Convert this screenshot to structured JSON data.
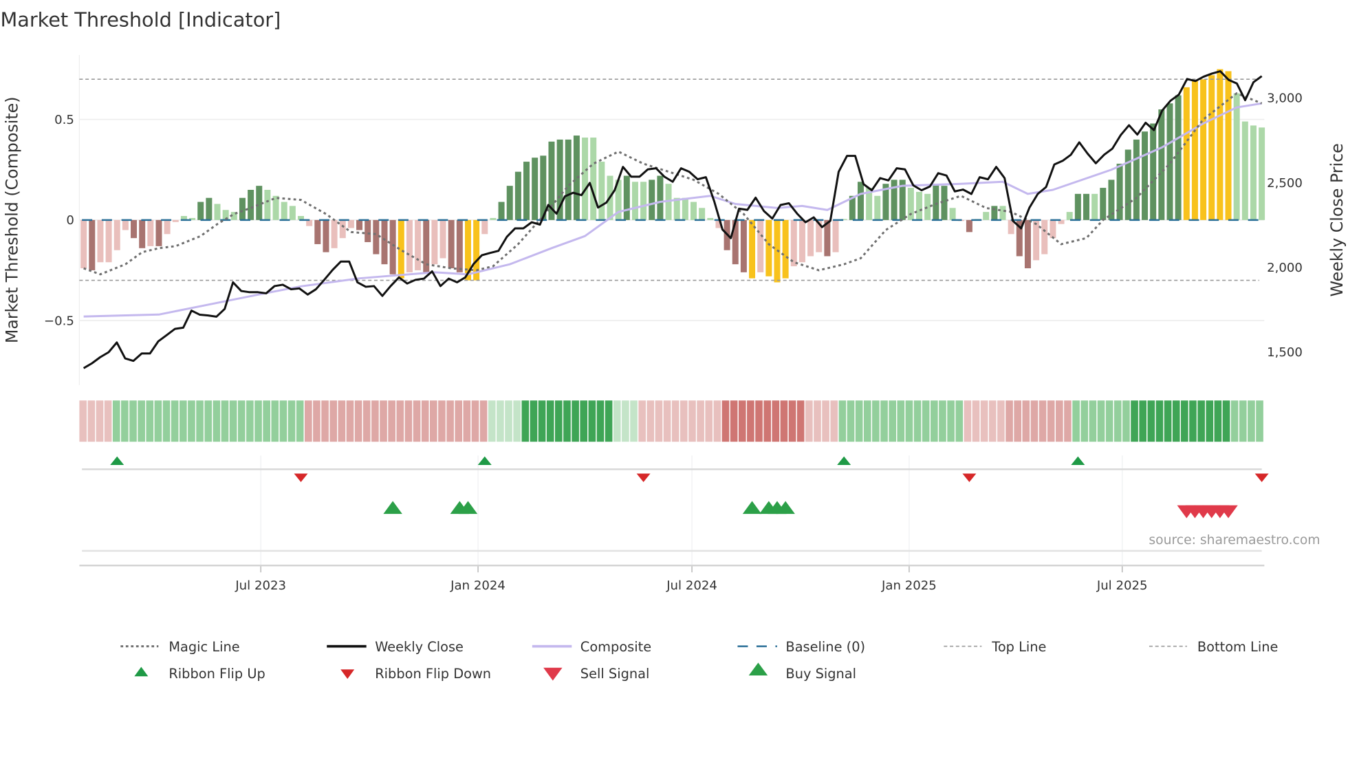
{
  "chart_data": {
    "type": "bar",
    "title": "Market Threshold [Indicator]",
    "ylabel": "Market Threshold (Composite)",
    "y2label": "Weekly Close Price",
    "ylim": [
      -0.85,
      0.82
    ],
    "y2lim": [
      1300,
      3350
    ],
    "left_ticks": [
      {
        "value": 0.5,
        "label": "0.5"
      },
      {
        "value": 0,
        "label": "0"
      },
      {
        "value": -0.5,
        "label": "−0.5"
      }
    ],
    "right_ticks": [
      {
        "value": 3000,
        "label": "3,000"
      },
      {
        "value": 2500,
        "label": "2,500"
      },
      {
        "value": 2000,
        "label": "2,000"
      },
      {
        "value": 1500,
        "label": "1,500"
      }
    ],
    "x_ticks": [
      {
        "week": 21.2,
        "label": "Jul 2023"
      },
      {
        "week": 47.2,
        "label": "Jan 2024"
      },
      {
        "week": 72.8,
        "label": "Jul 2024"
      },
      {
        "week": 98.8,
        "label": "Jan 2025"
      },
      {
        "week": 124.3,
        "label": "Jul 2025"
      }
    ],
    "top_line": 0.7,
    "bottom_line": -0.3,
    "baseline": 0,
    "bar_colors": {
      "pos_strong": "#5f9260",
      "pos_weak": "#acd8a8",
      "neg_strong": "#a87470",
      "neg_weak": "#e9bfbc",
      "extreme": "#f8c21c"
    },
    "bars": [
      [
        "w",
        -0.24
      ],
      [
        "s",
        -0.25
      ],
      [
        "w",
        -0.21
      ],
      [
        "w",
        -0.21
      ],
      [
        "w",
        -0.15
      ],
      [
        "w",
        -0.05
      ],
      [
        "s",
        -0.09
      ],
      [
        "s",
        -0.14
      ],
      [
        "w",
        -0.13
      ],
      [
        "s",
        -0.13
      ],
      [
        "w",
        -0.07
      ],
      [
        "w",
        -0.01
      ],
      [
        "w",
        0.02
      ],
      [
        "w",
        0.01
      ],
      [
        "s",
        0.09
      ],
      [
        "s",
        0.11
      ],
      [
        "w",
        0.08
      ],
      [
        "w",
        0.05
      ],
      [
        "w",
        0.04
      ],
      [
        "s",
        0.11
      ],
      [
        "s",
        0.15
      ],
      [
        "s",
        0.17
      ],
      [
        "w",
        0.15
      ],
      [
        "w",
        0.12
      ],
      [
        "w",
        0.09
      ],
      [
        "w",
        0.07
      ],
      [
        "w",
        0.02
      ],
      [
        "w",
        -0.03
      ],
      [
        "s",
        -0.12
      ],
      [
        "s",
        -0.16
      ],
      [
        "w",
        -0.14
      ],
      [
        "w",
        -0.09
      ],
      [
        "w",
        -0.04
      ],
      [
        "s",
        -0.05
      ],
      [
        "s",
        -0.11
      ],
      [
        "s",
        -0.17
      ],
      [
        "s",
        -0.22
      ],
      [
        "s",
        -0.27
      ],
      [
        "y",
        -0.29
      ],
      [
        "w",
        -0.26
      ],
      [
        "w",
        -0.25
      ],
      [
        "s",
        -0.26
      ],
      [
        "w",
        -0.22
      ],
      [
        "w",
        -0.19
      ],
      [
        "s",
        -0.24
      ],
      [
        "s",
        -0.26
      ],
      [
        "y",
        -0.3
      ],
      [
        "y",
        -0.3
      ],
      [
        "w",
        -0.07
      ],
      [
        "w",
        0.01
      ],
      [
        "s",
        0.09
      ],
      [
        "s",
        0.17
      ],
      [
        "s",
        0.24
      ],
      [
        "s",
        0.29
      ],
      [
        "s",
        0.31
      ],
      [
        "s",
        0.32
      ],
      [
        "s",
        0.39
      ],
      [
        "s",
        0.4
      ],
      [
        "s",
        0.4
      ],
      [
        "s",
        0.42
      ],
      [
        "w",
        0.41
      ],
      [
        "w",
        0.41
      ],
      [
        "w",
        0.29
      ],
      [
        "w",
        0.22
      ],
      [
        "w",
        0.2
      ],
      [
        "s",
        0.22
      ],
      [
        "w",
        0.19
      ],
      [
        "w",
        0.19
      ],
      [
        "s",
        0.2
      ],
      [
        "s",
        0.22
      ],
      [
        "w",
        0.18
      ],
      [
        "w",
        0.11
      ],
      [
        "w",
        0.11
      ],
      [
        "w",
        0.09
      ],
      [
        "w",
        0.06
      ],
      [
        "w",
        0.01
      ],
      [
        "w",
        -0.04
      ],
      [
        "s",
        -0.15
      ],
      [
        "s",
        -0.22
      ],
      [
        "s",
        -0.26
      ],
      [
        "y",
        -0.29
      ],
      [
        "w",
        -0.26
      ],
      [
        "y",
        -0.28
      ],
      [
        "y",
        -0.31
      ],
      [
        "y",
        -0.29
      ],
      [
        "w",
        -0.23
      ],
      [
        "w",
        -0.21
      ],
      [
        "w",
        -0.18
      ],
      [
        "w",
        -0.16
      ],
      [
        "s",
        -0.18
      ],
      [
        "w",
        -0.16
      ],
      [
        "w",
        0.005
      ],
      [
        "s",
        0.12
      ],
      [
        "s",
        0.19
      ],
      [
        "w",
        0.16
      ],
      [
        "w",
        0.12
      ],
      [
        "s",
        0.18
      ],
      [
        "s",
        0.2
      ],
      [
        "s",
        0.2
      ],
      [
        "w",
        0.16
      ],
      [
        "w",
        0.14
      ],
      [
        "w",
        0.13
      ],
      [
        "s",
        0.18
      ],
      [
        "s",
        0.17
      ],
      [
        "w",
        0.06
      ],
      [
        "w",
        -0.005
      ],
      [
        "s",
        -0.06
      ],
      [
        "w",
        0.005
      ],
      [
        "w",
        0.04
      ],
      [
        "s",
        0.07
      ],
      [
        "w",
        0.07
      ],
      [
        "w",
        -0.07
      ],
      [
        "s",
        -0.18
      ],
      [
        "s",
        -0.24
      ],
      [
        "w",
        -0.2
      ],
      [
        "w",
        -0.17
      ],
      [
        "w",
        -0.09
      ],
      [
        "w",
        -0.02
      ],
      [
        "w",
        0.04
      ],
      [
        "s",
        0.13
      ],
      [
        "s",
        0.13
      ],
      [
        "w",
        0.13
      ],
      [
        "s",
        0.16
      ],
      [
        "s",
        0.2
      ],
      [
        "s",
        0.28
      ],
      [
        "s",
        0.35
      ],
      [
        "s",
        0.4
      ],
      [
        "s",
        0.44
      ],
      [
        "s",
        0.48
      ],
      [
        "s",
        0.55
      ],
      [
        "s",
        0.58
      ],
      [
        "s",
        0.62
      ],
      [
        "y",
        0.66
      ],
      [
        "y",
        0.69
      ],
      [
        "y",
        0.7
      ],
      [
        "y",
        0.72
      ],
      [
        "y",
        0.75
      ],
      [
        "y",
        0.74
      ],
      [
        "w",
        0.63
      ],
      [
        "w",
        0.49
      ],
      [
        "w",
        0.47
      ],
      [
        "w",
        0.46
      ]
    ],
    "weekly_close": [
      1404,
      1433,
      1469,
      1498,
      1556,
      1462,
      1447,
      1491,
      1491,
      1563,
      1599,
      1636,
      1643,
      1744,
      1720,
      1715,
      1708,
      1754,
      1911,
      1860,
      1853,
      1853,
      1846,
      1889,
      1897,
      1870,
      1875,
      1839,
      1870,
      1926,
      1984,
      2034,
      2034,
      1911,
      1885,
      1889,
      1831,
      1889,
      1940,
      1904,
      1926,
      1933,
      1976,
      1889,
      1933,
      1911,
      1940,
      2020,
      2071,
      2085,
      2097,
      2179,
      2230,
      2230,
      2266,
      2252,
      2368,
      2317,
      2419,
      2440,
      2426,
      2498,
      2353,
      2382,
      2455,
      2593,
      2535,
      2535,
      2578,
      2585,
      2535,
      2505,
      2585,
      2564,
      2520,
      2532,
      2390,
      2223,
      2172,
      2346,
      2339,
      2411,
      2332,
      2288,
      2368,
      2378,
      2317,
      2266,
      2295,
      2237,
      2274,
      2564,
      2658,
      2658,
      2491,
      2455,
      2527,
      2513,
      2585,
      2578,
      2484,
      2455,
      2477,
      2556,
      2542,
      2448,
      2459,
      2433,
      2532,
      2520,
      2593,
      2527,
      2274,
      2230,
      2353,
      2433,
      2474,
      2607,
      2629,
      2665,
      2738,
      2672,
      2614,
      2665,
      2701,
      2781,
      2839,
      2784,
      2854,
      2810,
      2926,
      2984,
      3020,
      3112,
      3100,
      3126,
      3144,
      3158,
      3107,
      3086,
      2987,
      3093,
      3129
    ],
    "composite": [
      [
        0,
        -0.48
      ],
      [
        9,
        -0.47
      ],
      [
        15,
        -0.42
      ],
      [
        21,
        -0.37
      ],
      [
        26,
        -0.33
      ],
      [
        33,
        -0.29
      ],
      [
        36,
        -0.28
      ],
      [
        42,
        -0.26
      ],
      [
        46,
        -0.27
      ],
      [
        51,
        -0.22
      ],
      [
        56,
        -0.14
      ],
      [
        60,
        -0.08
      ],
      [
        64,
        0.04
      ],
      [
        69,
        0.09
      ],
      [
        75,
        0.12
      ],
      [
        78,
        0.08
      ],
      [
        83,
        0.06
      ],
      [
        86,
        0.07
      ],
      [
        89,
        0.05
      ],
      [
        93,
        0.13
      ],
      [
        98,
        0.17
      ],
      [
        105,
        0.18
      ],
      [
        110,
        0.19
      ],
      [
        113,
        0.13
      ],
      [
        116,
        0.15
      ],
      [
        123,
        0.25
      ],
      [
        129,
        0.36
      ],
      [
        134,
        0.48
      ],
      [
        138,
        0.56
      ],
      [
        141,
        0.58
      ]
    ],
    "magic_line": [
      [
        0,
        -0.24
      ],
      [
        2,
        -0.27
      ],
      [
        5,
        -0.22
      ],
      [
        7,
        -0.16
      ],
      [
        9,
        -0.14
      ],
      [
        11,
        -0.13
      ],
      [
        14,
        -0.08
      ],
      [
        16,
        -0.02
      ],
      [
        18,
        0.03
      ],
      [
        20,
        0.06
      ],
      [
        23,
        0.11
      ],
      [
        26,
        0.1
      ],
      [
        29,
        0.03
      ],
      [
        32,
        -0.06
      ],
      [
        35,
        -0.07
      ],
      [
        38,
        -0.15
      ],
      [
        41,
        -0.22
      ],
      [
        44,
        -0.24
      ],
      [
        47,
        -0.25
      ],
      [
        49,
        -0.23
      ],
      [
        52,
        -0.12
      ],
      [
        55,
        0.02
      ],
      [
        58,
        0.17
      ],
      [
        61,
        0.28
      ],
      [
        64,
        0.34
      ],
      [
        67,
        0.28
      ],
      [
        70,
        0.24
      ],
      [
        73,
        0.2
      ],
      [
        76,
        0.13
      ],
      [
        79,
        0.03
      ],
      [
        82,
        -0.12
      ],
      [
        85,
        -0.21
      ],
      [
        88,
        -0.25
      ],
      [
        91,
        -0.22
      ],
      [
        93,
        -0.19
      ],
      [
        96,
        -0.05
      ],
      [
        99,
        0.03
      ],
      [
        102,
        0.08
      ],
      [
        105,
        0.12
      ],
      [
        108,
        0.06
      ],
      [
        111,
        0.04
      ],
      [
        114,
        -0.02
      ],
      [
        117,
        -0.12
      ],
      [
        120,
        -0.09
      ],
      [
        122,
        0.0
      ],
      [
        126,
        0.11
      ],
      [
        130,
        0.28
      ],
      [
        134,
        0.5
      ],
      [
        138,
        0.63
      ],
      [
        141,
        0.58
      ]
    ],
    "ribbon_strength": [
      -1,
      -1,
      -1,
      -1,
      2,
      2,
      2,
      2,
      2,
      2,
      2,
      2,
      2,
      2,
      2,
      2,
      2,
      2,
      2,
      2,
      2,
      2,
      2,
      2,
      2,
      2,
      2,
      -2,
      -2,
      -2,
      -2,
      -2,
      -2,
      -2,
      -2,
      -2,
      -2,
      -2,
      -2,
      -2,
      -2,
      -2,
      -2,
      -2,
      -2,
      -2,
      -2,
      -2,
      -2,
      1,
      1,
      1,
      1,
      3,
      3,
      3,
      3,
      3,
      3,
      3,
      3,
      3,
      3,
      3,
      1,
      1,
      1,
      -1,
      -1,
      -1,
      -1,
      -1,
      -1,
      -1,
      -1,
      -1,
      -1,
      -3,
      -3,
      -3,
      -3,
      -3,
      -3,
      -3,
      -3,
      -3,
      -3,
      -1,
      -1,
      -1,
      -1,
      2,
      2,
      2,
      2,
      2,
      2,
      2,
      2,
      2,
      2,
      2,
      2,
      2,
      2,
      2,
      -1,
      -1,
      -1,
      -1,
      -1,
      -2,
      -2,
      -2,
      -2,
      -2,
      -2,
      -2,
      -2,
      2,
      2,
      2,
      2,
      2,
      2,
      2,
      3,
      3,
      3,
      3,
      3,
      3,
      3,
      3,
      3,
      3,
      3,
      3,
      2,
      2,
      2,
      2
    ],
    "ribbon_flip_up_weeks": [
      4,
      48,
      91,
      119
    ],
    "ribbon_flip_down_weeks": [
      26,
      67,
      106,
      141
    ],
    "buy_signal_weeks": [
      37,
      45,
      46,
      80,
      82,
      83,
      84
    ],
    "sell_signal_weeks": [
      132,
      133,
      134,
      135,
      136,
      137
    ],
    "colors": {
      "close": "#111111",
      "composite": "#c4b8ee",
      "magic": "#707070",
      "baseline": "#2a6f97",
      "guide": "#999999",
      "flip_up": "#1f9a46",
      "flip_down": "#d62728",
      "buy": "#2ca048",
      "sell": "#e03a4a"
    },
    "legend": [
      {
        "key": "magic",
        "label": "Magic Line"
      },
      {
        "key": "close",
        "label": "Weekly Close"
      },
      {
        "key": "composite",
        "label": "Composite"
      },
      {
        "key": "baseline",
        "label": "Baseline (0)"
      },
      {
        "key": "top",
        "label": "Top Line"
      },
      {
        "key": "bottom",
        "label": "Bottom Line"
      },
      {
        "key": "flip_up",
        "label": "Ribbon Flip Up"
      },
      {
        "key": "flip_down",
        "label": "Ribbon Flip Down"
      },
      {
        "key": "sell",
        "label": "Sell Signal"
      },
      {
        "key": "buy",
        "label": "Buy Signal"
      }
    ],
    "source": "source: sharemaestro.com"
  }
}
